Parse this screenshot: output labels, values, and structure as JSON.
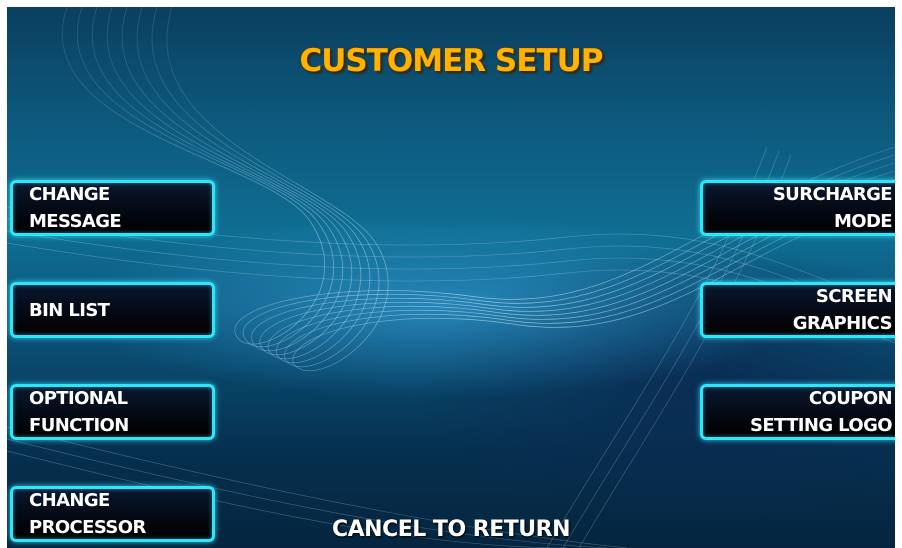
{
  "screen": {
    "title": "CUSTOMER SETUP",
    "footer": "CANCEL TO RETURN"
  },
  "left_buttons": [
    {
      "line1": "CHANGE",
      "line2": "MESSAGE"
    },
    {
      "line1": "BIN LIST",
      "line2": ""
    },
    {
      "line1": "OPTIONAL",
      "line2": "FUNCTION"
    },
    {
      "line1": "CHANGE",
      "line2": "PROCESSOR"
    }
  ],
  "right_buttons": [
    {
      "line1": "SURCHARGE",
      "line2": "MODE"
    },
    {
      "line1": "SCREEN",
      "line2": "GRAPHICS"
    },
    {
      "line1": "COUPON",
      "line2": "SETTING LOGO"
    }
  ],
  "colors": {
    "title": "#ffb300",
    "button_border": "#2ee6f5",
    "background": "#0a4f75"
  }
}
